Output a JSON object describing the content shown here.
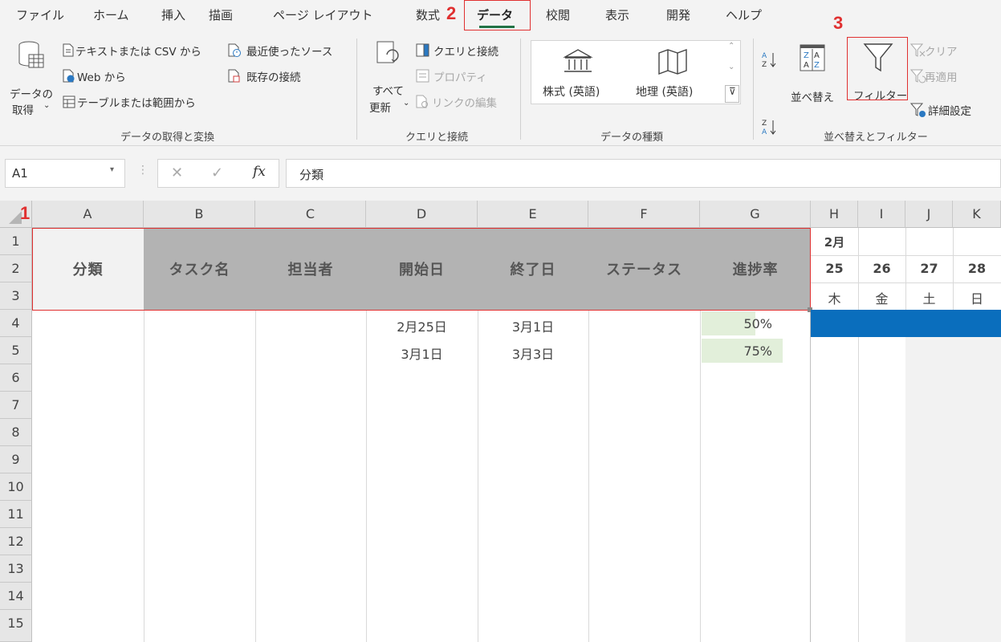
{
  "tabs": [
    "ファイル",
    "ホーム",
    "挿入",
    "描画",
    "ページ レイアウト",
    "数式",
    "データ",
    "校閲",
    "表示",
    "開発",
    "ヘルプ"
  ],
  "markers": {
    "m1": "1",
    "m2": "2",
    "m3": "3"
  },
  "ribbon": {
    "get_data": {
      "l1": "データの",
      "l2": "取得"
    },
    "text_csv": "テキストまたは CSV から",
    "web": "Web から",
    "table_range": "テーブルまたは範囲から",
    "recent_sources": "最近使ったソース",
    "existing_conn": "既存の接続",
    "group1": "データの取得と変換",
    "refresh_all": {
      "l1": "すべて",
      "l2": "更新"
    },
    "queries_conn": "クエリと接続",
    "properties": "プロパティ",
    "edit_links": "リンクの編集",
    "group2": "クエリと接続",
    "stocks": "株式 (英語)",
    "geography": "地理 (英語)",
    "group3": "データの種類",
    "sort": "並べ替え",
    "filter": "フィルター",
    "clear": "クリア",
    "reapply": "再適用",
    "advanced": "詳細設定",
    "group4": "並べ替えとフィルター"
  },
  "formula_bar": {
    "name_box": "A1",
    "fx": "fx",
    "content": "分類"
  },
  "columns": [
    "A",
    "B",
    "C",
    "D",
    "E",
    "F",
    "G",
    "H",
    "I",
    "J",
    "K"
  ],
  "rows": [
    "1",
    "2",
    "3",
    "4",
    "5",
    "6",
    "7",
    "8",
    "9",
    "10",
    "11",
    "12",
    "13",
    "14",
    "15"
  ],
  "sheet": {
    "headers": [
      "分類",
      "タスク名",
      "担当者",
      "開始日",
      "終了日",
      "ステータス",
      "進捗率"
    ],
    "month": "2月",
    "days": [
      "25",
      "26",
      "27",
      "28"
    ],
    "weekdays": [
      "木",
      "金",
      "土",
      "日"
    ],
    "data": [
      {
        "start": "2月25日",
        "end": "3月1日",
        "progress": "50%",
        "progress_value": 0.5
      },
      {
        "start": "3月1日",
        "end": "3月3日",
        "progress": "75%",
        "progress_value": 0.75
      }
    ]
  },
  "colors": {
    "header_gray": "#b3b3b3",
    "header_light": "#f2f2f2",
    "gantt_blue": "#0a6ebd",
    "progress_fill": "#e2efda",
    "marker_red": "#e03030"
  }
}
